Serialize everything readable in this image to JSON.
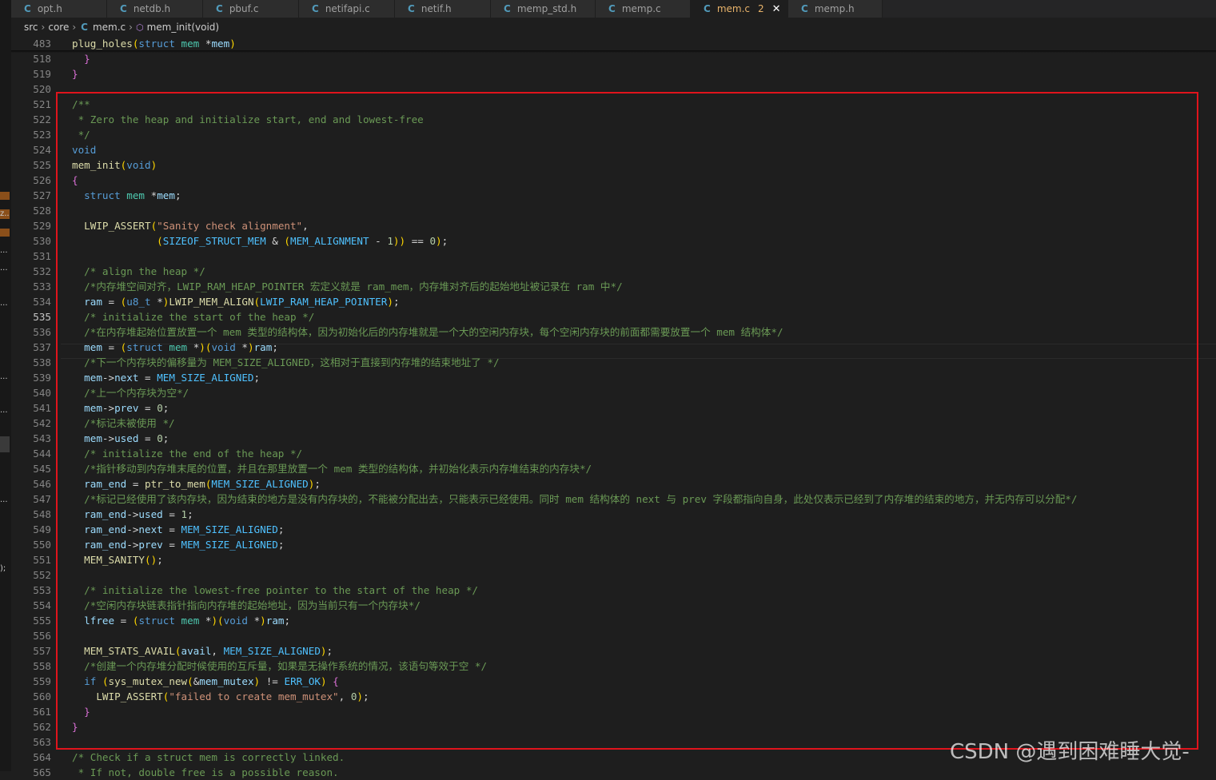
{
  "tabs": [
    {
      "icon_letter": "C",
      "label": "opt.h",
      "active": false
    },
    {
      "icon_letter": "C",
      "label": "netdb.h",
      "active": false
    },
    {
      "icon_letter": "C",
      "label": "pbuf.c",
      "active": false
    },
    {
      "icon_letter": "C",
      "label": "netifapi.c",
      "active": false
    },
    {
      "icon_letter": "C",
      "label": "netif.h",
      "active": false
    },
    {
      "icon_letter": "C",
      "label": "memp_std.h",
      "active": false
    },
    {
      "icon_letter": "C",
      "label": "memp.c",
      "active": false
    },
    {
      "icon_letter": "C",
      "label": "mem.c",
      "active": true,
      "badge": "2"
    },
    {
      "icon_letter": "C",
      "label": "memp.h",
      "active": false
    }
  ],
  "breadcrumb": {
    "parts": [
      "src",
      "core",
      "mem.c",
      "mem_init(void)"
    ],
    "file_icon": "C"
  },
  "left_gutter_fragments": [
    "z..",
    "...",
    "...",
    "...",
    "...",
    "...",
    "...",
    ");"
  ],
  "watermark": "CSDN @遇到困难睡大觉-",
  "current_line": 535,
  "lines": [
    {
      "no": "483",
      "code": "plug_holes(struct mem *mem)"
    },
    {
      "no": "518",
      "code": "  }"
    },
    {
      "no": "519",
      "code": "}"
    },
    {
      "no": "520",
      "code": ""
    },
    {
      "no": "521",
      "code": "/**"
    },
    {
      "no": "522",
      "code": " * Zero the heap and initialize start, end and lowest-free"
    },
    {
      "no": "523",
      "code": " */"
    },
    {
      "no": "524",
      "code": "void"
    },
    {
      "no": "525",
      "code": "mem_init(void)"
    },
    {
      "no": "526",
      "code": "{"
    },
    {
      "no": "527",
      "code": "  struct mem *mem;"
    },
    {
      "no": "528",
      "code": ""
    },
    {
      "no": "529",
      "code": "  LWIP_ASSERT(\"Sanity check alignment\","
    },
    {
      "no": "530",
      "code": "              (SIZEOF_STRUCT_MEM & (MEM_ALIGNMENT - 1)) == 0);"
    },
    {
      "no": "531",
      "code": ""
    },
    {
      "no": "532",
      "code": "  /* align the heap */"
    },
    {
      "no": "533",
      "code": "  /*内存堆空间对齐，LWIP_RAM_HEAP_POINTER 宏定义就是 ram_mem，内存堆对齐后的起始地址被记录在 ram 中*/"
    },
    {
      "no": "534",
      "code": "  ram = (u8_t *)LWIP_MEM_ALIGN(LWIP_RAM_HEAP_POINTER);"
    },
    {
      "no": "535",
      "code": "  /* initialize the start of the heap */"
    },
    {
      "no": "536",
      "code": "  /*在内存堆起始位置放置一个 mem 类型的结构体，因为初始化后的内存堆就是一个大的空闲内存块，每个空闲内存块的前面都需要放置一个 mem 结构体*/"
    },
    {
      "no": "537",
      "code": "  mem = (struct mem *)(void *)ram;"
    },
    {
      "no": "538",
      "code": "  /*下一个内存块的偏移量为 MEM_SIZE_ALIGNED，这相对于直接到内存堆的结束地址了 */"
    },
    {
      "no": "539",
      "code": "  mem->next = MEM_SIZE_ALIGNED;"
    },
    {
      "no": "540",
      "code": "  /*上一个内存块为空*/"
    },
    {
      "no": "541",
      "code": "  mem->prev = 0;"
    },
    {
      "no": "542",
      "code": "  /*标记未被使用 */"
    },
    {
      "no": "543",
      "code": "  mem->used = 0;"
    },
    {
      "no": "544",
      "code": "  /* initialize the end of the heap */"
    },
    {
      "no": "545",
      "code": "  /*指针移动到内存堆末尾的位置，并且在那里放置一个 mem 类型的结构体，并初始化表示内存堆结束的内存块*/"
    },
    {
      "no": "546",
      "code": "  ram_end = ptr_to_mem(MEM_SIZE_ALIGNED);"
    },
    {
      "no": "547",
      "code": "  /*标记已经使用了该内存块，因为结束的地方是没有内存块的，不能被分配出去，只能表示已经使用。同时 mem 结构体的 next 与 prev 字段都指向自身，此处仅表示已经到了内存堆的结束的地方，并无内存可以分配*/"
    },
    {
      "no": "548",
      "code": "  ram_end->used = 1;"
    },
    {
      "no": "549",
      "code": "  ram_end->next = MEM_SIZE_ALIGNED;"
    },
    {
      "no": "550",
      "code": "  ram_end->prev = MEM_SIZE_ALIGNED;"
    },
    {
      "no": "551",
      "code": "  MEM_SANITY();"
    },
    {
      "no": "552",
      "code": ""
    },
    {
      "no": "553",
      "code": "  /* initialize the lowest-free pointer to the start of the heap */"
    },
    {
      "no": "554",
      "code": "  /*空闲内存块链表指针指向内存堆的起始地址，因为当前只有一个内存块*/"
    },
    {
      "no": "555",
      "code": "  lfree = (struct mem *)(void *)ram;"
    },
    {
      "no": "556",
      "code": ""
    },
    {
      "no": "557",
      "code": "  MEM_STATS_AVAIL(avail, MEM_SIZE_ALIGNED);"
    },
    {
      "no": "558",
      "code": "  /*创建一个内存堆分配时候使用的互斥量，如果是无操作系统的情况，该语句等效于空 */"
    },
    {
      "no": "559",
      "code": "  if (sys_mutex_new(&mem_mutex) != ERR_OK) {"
    },
    {
      "no": "560",
      "code": "    LWIP_ASSERT(\"failed to create mem_mutex\", 0);"
    },
    {
      "no": "561",
      "code": "  }"
    },
    {
      "no": "562",
      "code": "}"
    },
    {
      "no": "563",
      "code": ""
    },
    {
      "no": "564",
      "code": "/* Check if a struct mem is correctly linked."
    },
    {
      "no": "565",
      "code": " * If not, double free is a possible reason."
    }
  ]
}
